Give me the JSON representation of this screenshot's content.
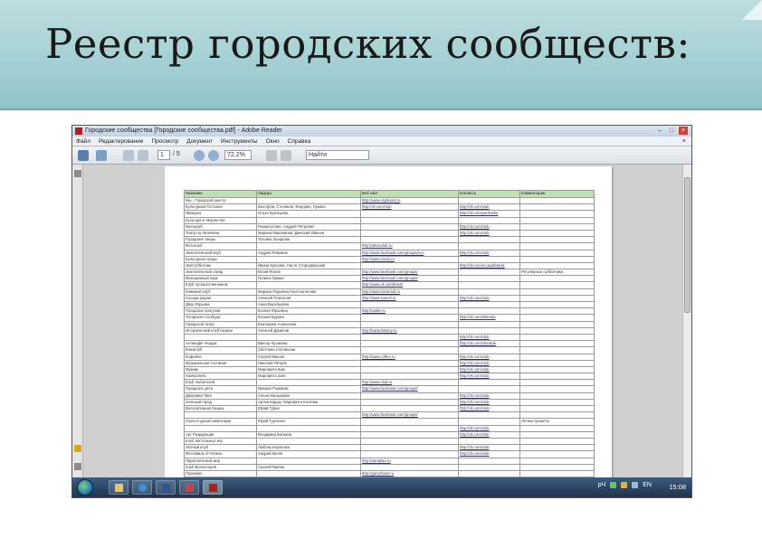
{
  "slide": {
    "title": "Реестр городских сообществ:"
  },
  "window": {
    "title": "Городские сообщества  [Городские сообщества.pdf] - Adobe Reader",
    "menu": [
      "Файл",
      "Редактирование",
      "Просмотр",
      "Документ",
      "Инструменты",
      "Окно",
      "Справка"
    ],
    "menu_close": "×",
    "controls": {
      "minimize": "–",
      "maximize": "□",
      "close": "×"
    }
  },
  "toolbar": {
    "page_current": "1",
    "page_total": "/ 5",
    "zoom": "72,2%",
    "find_placeholder": "Найти"
  },
  "table": {
    "headers": [
      "Название",
      "Лидеры",
      "Веб-сайт",
      "Контакты",
      "Комментарии"
    ],
    "rows": [
      [
        "Мы - Городской реестр",
        "",
        "http://www.cityboard.ru",
        "",
        ""
      ],
      [
        "Культурная Гостиная",
        "Бекторов, Степанов, Федорин, Лукина",
        "http://vk.com/club",
        "http://vk.com/club",
        ""
      ],
      [
        "Ярмарка",
        "Ольга Кузнецова",
        "",
        "http://vk.com/yarmarka",
        ""
      ],
      [
        "Культура и творчество",
        "",
        "",
        "",
        ""
      ],
      [
        "Велоклуб",
        "Рахматуллин, Андрей Петрович",
        "",
        "http://vk.com/club",
        ""
      ],
      [
        "Театр на Литейном",
        "Марина Максимова, Дмитрий Иванов",
        "",
        "http://vk.com/club",
        ""
      ],
      [
        "Городские танцы",
        "Татьяна Захарова",
        "",
        "",
        ""
      ],
      [
        "Фотоклуб",
        "",
        "http://photoclub.ru",
        "",
        ""
      ],
      [
        "Экологический клуб",
        "Андрей Романов",
        "http://www.facebook.com/groups/eco",
        "http://vk.com/club",
        ""
      ],
      [
        "Культурная среда",
        "",
        "http://www.sreda.ru",
        "",
        ""
      ],
      [
        "ЭкоСубботник",
        "Ирина Купцова, Настя Стародворская",
        "",
        "http://vk.com/ecosubbotnik",
        ""
      ],
      [
        "Экологический отряд",
        "Юлий Фонов",
        "http://www.facebook.com/groups/",
        "",
        "Регулярные субботники"
      ],
      [
        "Молодежный парк",
        "Галина Лукина",
        "http://www.facebook.com/groups/",
        "",
        ""
      ],
      [
        "Клуб путешественников",
        "",
        "http://www.vk.com/travel",
        "",
        ""
      ],
      [
        "Книжный клуб",
        "Марина Юрьевна Константинова",
        "http://www.bookclub.ru",
        "",
        ""
      ],
      [
        "Соседи рядом",
        "Алексей Платонов",
        "http://www.sosedi.ru",
        "http://vk.com/club",
        ""
      ],
      [
        "Двор Юрьева",
        "Анна Васильевна",
        "",
        "",
        ""
      ],
      [
        "Городские прогулки",
        "Ксения Юрьевна",
        "http://walks.ru",
        "",
        ""
      ],
      [
        "Татарская Слобода",
        "Ксения Бурова",
        "",
        "http://vk.com/sloboda",
        ""
      ],
      [
        "Городской театр",
        "Екатерина Алексеева",
        "",
        "",
        ""
      ],
      [
        "Исторический клуб Казани",
        "Алексей Данилов",
        "http://kazanhistory.ru",
        "",
        ""
      ],
      [
        "",
        "",
        "",
        "http://vk.com/club",
        ""
      ],
      [
        "Антикафе Чердак",
        "Виктор Куликова",
        "",
        "http://vk.com/cherdak",
        ""
      ],
      [
        "Киноклуб",
        "Светлана Соловьева",
        "",
        "",
        ""
      ],
      [
        "Кофейня",
        "Сергей Иванов",
        "http://www.coffee.ru",
        "http://vk.com/club",
        ""
      ],
      [
        "Музыкальная Гостиная",
        "Николай Петров",
        "",
        "http://vk.com/club",
        ""
      ],
      [
        "Мурзик",
        "Маргарита Ким",
        "",
        "http://vk.com/club",
        ""
      ],
      [
        "Хакерспейс",
        "Маргарита Заес",
        "",
        "http://vk.com/club",
        ""
      ],
      [
        "Клуб любителей",
        "",
        "http://www.club.ru",
        "",
        ""
      ],
      [
        "Городские дети",
        "Михаил Рыжиков",
        "http://www.facebook.com/groups/",
        "",
        ""
      ],
      [
        "Дворовая Лига",
        "Алена Малышева",
        "",
        "http://vk.com/club",
        ""
      ],
      [
        "Зеленый город",
        "Артем Кадыр, Маргарита Козлова",
        "",
        "http://vk.com/club",
        ""
      ],
      [
        "Велосипедная Казань",
        "Юрий Турин",
        "",
        "http://vk.com/club",
        ""
      ],
      [
        "",
        "",
        "http://www.facebook.com/groups/",
        "",
        ""
      ],
      [
        "Скульптурный симпозиум",
        "Юрий Турченко",
        "",
        "",
        "Летние проекты"
      ],
      [
        "",
        "",
        "",
        "http://vk.com/club",
        ""
      ],
      [
        "Арт Резиденция",
        "Владимир Беликов",
        "",
        "http://vk.com/club",
        ""
      ],
      [
        "Клуб настольных игр",
        "",
        "",
        "",
        ""
      ],
      [
        "Уютный клуб",
        "Любовь Борисова",
        "",
        "http://vk.com/club",
        ""
      ],
      [
        "Фестиваль Оттепель",
        "Андрей Кисев",
        "",
        "http://vk.com/club",
        ""
      ],
      [
        "Параллельный мир",
        "",
        "http://paraplan.ru",
        "",
        ""
      ],
      [
        "Клуб Волонтеров",
        "Сергей Павлов",
        "",
        "",
        ""
      ],
      [
        "Горожане",
        "",
        "http://gorozhane.ru",
        "",
        ""
      ]
    ]
  },
  "taskbar": {
    "lang": "EN",
    "clock": "15:08",
    "tray_label": "рЧ"
  },
  "colors": {
    "header_top": "#bfdee0",
    "header_bottom": "#8fc4c8",
    "table_header": "#bfe0b0",
    "taskbar": "#1d3350"
  }
}
